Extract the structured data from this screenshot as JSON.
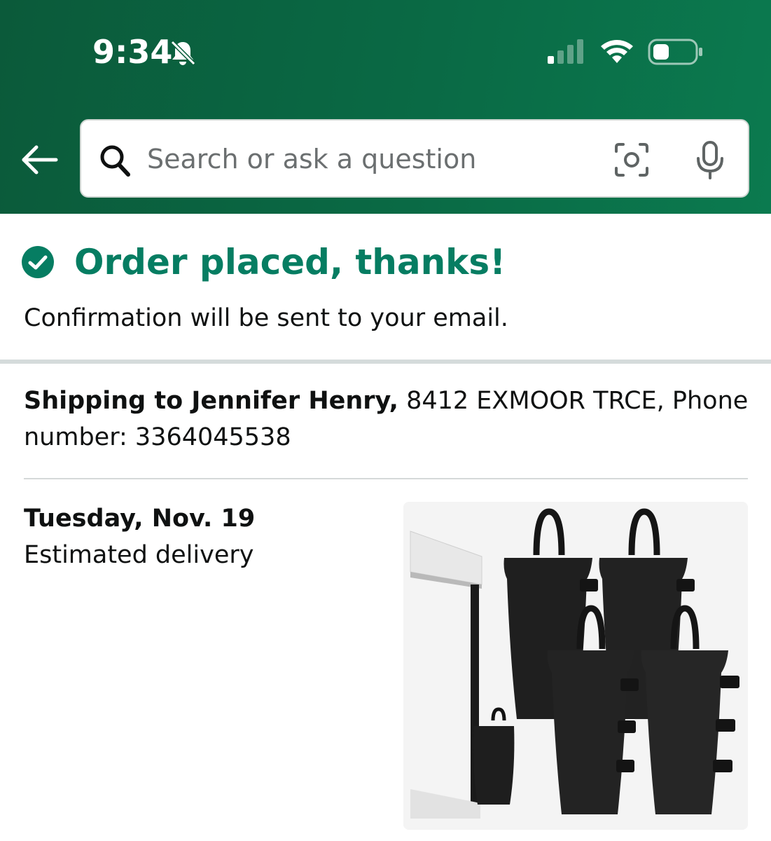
{
  "status_bar": {
    "time": "9:34",
    "icons": [
      "bell-slash-icon",
      "signal-icon",
      "wifi-icon",
      "battery-icon"
    ]
  },
  "search": {
    "placeholder": "Search or ask a question",
    "icons": [
      "back-arrow-icon",
      "search-icon",
      "camera-icon",
      "mic-icon"
    ]
  },
  "confirmation": {
    "title": "Order placed, thanks!",
    "subtitle": "Confirmation will be sent to your email."
  },
  "shipping": {
    "label": "Shipping to Jennifer Henry,",
    "address": " 8412 EXMOOR TRCE, Phone number: 3364045538"
  },
  "delivery": {
    "date": "Tuesday, Nov. 19",
    "label": "Estimated delivery"
  },
  "product": {
    "image_icon": "canopy-weight-bags-image"
  },
  "colors": {
    "header_dark": "#0b5a3a",
    "header_light": "#0b7a4f",
    "success_green": "#067d62",
    "divider": "#d5dbdb"
  }
}
